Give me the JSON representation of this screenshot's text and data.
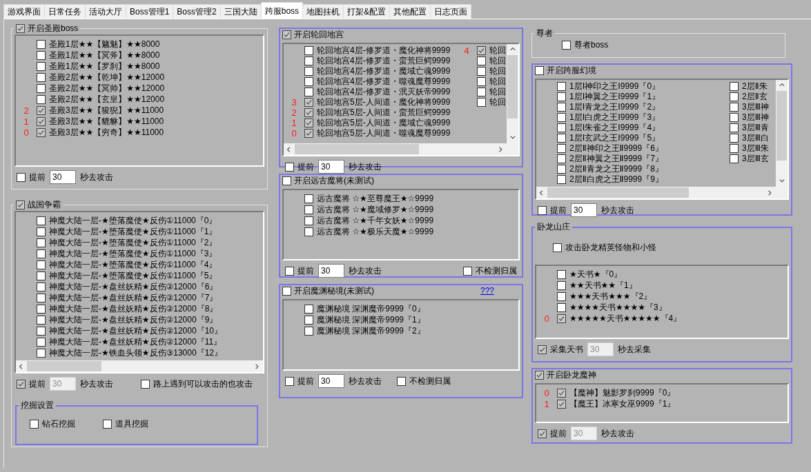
{
  "tabs": [
    {
      "label": "游戏界面",
      "selected": false
    },
    {
      "label": "日常任务",
      "selected": false
    },
    {
      "label": "活动大厅",
      "selected": false
    },
    {
      "label": "Boss管理1",
      "selected": false
    },
    {
      "label": "Boss管理2",
      "selected": false
    },
    {
      "label": "三国大陆",
      "selected": false
    },
    {
      "label": "跨服boss",
      "selected": true
    },
    {
      "label": "地图挂机",
      "selected": false
    },
    {
      "label": "打架&配置",
      "selected": false
    },
    {
      "label": "其他配置",
      "selected": false
    },
    {
      "label": "日志页面",
      "selected": false
    }
  ],
  "columns": [
    [
      {
        "kind": "etched",
        "title": "开启圣殿boss",
        "title_checked": true,
        "list": {
          "kind": "plain",
          "columns": [
            [
              {
                "checked": false,
                "label": "圣殿1层★★【魑魅】★★8000"
              },
              {
                "checked": false,
                "label": "圣殿1层★★【冥斧】★★8000"
              },
              {
                "checked": false,
                "label": "圣殿1层★★【罗刹】★★8000"
              },
              {
                "checked": false,
                "label": "圣殿2层★★【乾坤】★★12000"
              },
              {
                "checked": false,
                "label": "圣殿2层★★【冥帅】★★12000"
              },
              {
                "checked": false,
                "label": "圣殿2层★★【玄皇】★★12000"
              },
              {
                "order": "2",
                "checked": true,
                "label": "圣殿3层★★【狻猊】★★11000"
              },
              {
                "order": "1",
                "checked": true,
                "label": "圣殿3层★★【貔貅】★★11000"
              },
              {
                "order": "0",
                "checked": true,
                "label": "圣殿3层★★【穷奇】★★11000"
              }
            ]
          ]
        },
        "footer": [
          {
            "kind": "checkbox",
            "label": "提前",
            "checked": false
          },
          {
            "kind": "field",
            "value": "30",
            "disabled": false
          },
          {
            "kind": "text",
            "text": "秒去攻击"
          }
        ]
      },
      {
        "kind": "etched",
        "title": "战国争霸",
        "title_checked": true,
        "list": {
          "kind": "hscroll",
          "columns": [
            [
              {
                "checked": false,
                "label": "神魔大陆一层-★堕落魔使★反伤①11000『0』"
              },
              {
                "checked": false,
                "label": "神魔大陆一层-★堕落魔使★反伤①11000『1』"
              },
              {
                "checked": false,
                "label": "神魔大陆一层-★堕落魔使★反伤①11000『2』"
              },
              {
                "checked": false,
                "label": "神魔大陆一层-★堕落魔使★反伤①11000『3』"
              },
              {
                "checked": false,
                "label": "神魔大陆一层-★堕落魔使★反伤①11000『4』"
              },
              {
                "checked": false,
                "label": "神魔大陆一层-★堕落魔使★反伤①11000『5』"
              },
              {
                "checked": false,
                "label": "神魔大陆一层-★盘丝妖精★反伤②12000『6』"
              },
              {
                "checked": false,
                "label": "神魔大陆一层-★盘丝妖精★反伤②12000『7』"
              },
              {
                "checked": false,
                "label": "神魔大陆一层-★盘丝妖精★反伤②12000『8』"
              },
              {
                "checked": false,
                "label": "神魔大陆一层-★盘丝妖精★反伤②12000『9』"
              },
              {
                "checked": false,
                "label": "神魔大陆一层-★盘丝妖精★反伤②12000『10』"
              },
              {
                "checked": false,
                "label": "神魔大陆一层-★盘丝妖精★反伤②12000『11』"
              },
              {
                "checked": false,
                "label": "神魔大陆一层-★铁血头领★反伤③13000『12』"
              }
            ]
          ]
        },
        "footer": [
          {
            "kind": "checkbox",
            "label": "提前",
            "checked": true
          },
          {
            "kind": "field",
            "value": "30",
            "disabled": true
          },
          {
            "kind": "text",
            "text": "秒去攻击"
          },
          {
            "kind": "checkbox",
            "label": "路上遇到可以攻击的也攻击",
            "checked": false
          }
        ],
        "subpanels": [
          {
            "kind": "accent",
            "title": "挖掘设置",
            "options": [
              {
                "label": "钻石挖掘",
                "checked": false
              },
              {
                "label": "道具挖掘",
                "checked": false
              }
            ]
          }
        ]
      }
    ],
    [
      {
        "kind": "accent",
        "title": "开启轮回地宫",
        "title_checked": true,
        "list": {
          "kind": "scroll",
          "columns": [
            [
              {
                "checked": false,
                "label": "轮回地宫4层-修罗道・魔化神将9999"
              },
              {
                "checked": false,
                "label": "轮回地宫4层-修罗道・蛮荒巨鳄9999"
              },
              {
                "checked": false,
                "label": "轮回地宫4层-修罗道・魔域亡魂9999"
              },
              {
                "checked": false,
                "label": "轮回地宫4层-修罗道・噬魂魔尊9999"
              },
              {
                "checked": false,
                "label": "轮回地宫4层-修罗道・泯灭妖帝9999"
              },
              {
                "order": "3",
                "checked": true,
                "label": "轮回地宫5层-人间道・魔化神将9999"
              },
              {
                "order": "2",
                "checked": true,
                "label": "轮回地宫5层-人间道・蛮荒巨鳄9999"
              },
              {
                "order": "1",
                "checked": true,
                "label": "轮回地宫5层-人间道・魔域亡魂9999"
              },
              {
                "order": "0",
                "checked": true,
                "label": "轮回地宫5层-人间道・噬魂魔尊9999"
              }
            ],
            [
              {
                "order": "4",
                "checked": true,
                "label": "轮回"
              },
              {
                "checked": false,
                "label": "轮回"
              },
              {
                "checked": false,
                "label": "轮回"
              },
              {
                "checked": false,
                "label": "轮回"
              },
              {
                "checked": false,
                "label": "轮回"
              },
              {
                "checked": false,
                "label": "轮回"
              }
            ]
          ]
        },
        "footer": [
          {
            "kind": "checkbox",
            "label": "提前",
            "checked": false
          },
          {
            "kind": "field",
            "value": "30",
            "disabled": false
          },
          {
            "kind": "text",
            "text": "秒去攻击"
          }
        ]
      },
      {
        "kind": "accent",
        "title": "开启远古魔将(未测试)",
        "title_checked": false,
        "list": {
          "kind": "plain",
          "columns": [
            [
              {
                "checked": false,
                "label": "远古魔将 ☆★至尊魔王★☆9999"
              },
              {
                "checked": false,
                "label": "远古魔将 ☆★魔域修罗★☆9999"
              },
              {
                "checked": false,
                "label": "远古魔将 ☆★千年女妖★☆9999"
              },
              {
                "checked": false,
                "label": "远古魔将 ☆★极乐天魔★☆9999"
              }
            ]
          ]
        },
        "footer": [
          {
            "kind": "checkbox",
            "label": "提前",
            "checked": false
          },
          {
            "kind": "field",
            "value": "30",
            "disabled": false
          },
          {
            "kind": "text",
            "text": "秒去攻击"
          },
          {
            "kind": "checkbox",
            "label": "不检测归属",
            "checked": false
          }
        ]
      },
      {
        "kind": "accent",
        "title": "开启魔渊秘境(未测试)",
        "title_checked": false,
        "link": "???",
        "list": {
          "kind": "plain",
          "columns": [
            [
              {
                "checked": false,
                "label": "魔渊秘境 深渊魔帝9999『0』"
              },
              {
                "checked": false,
                "label": "魔渊秘境 深渊魔帝9999『1』"
              },
              {
                "checked": false,
                "label": "魔渊秘境 深渊魔帝9999『2』"
              }
            ]
          ]
        },
        "footer": [
          {
            "kind": "checkbox",
            "label": "提前",
            "checked": false
          },
          {
            "kind": "field",
            "value": "30",
            "disabled": false
          },
          {
            "kind": "text",
            "text": "秒去攻击"
          },
          {
            "kind": "checkbox",
            "label": "不检测归属",
            "checked": false
          }
        ]
      }
    ],
    [
      {
        "kind": "etched",
        "title": "尊者",
        "options": [
          {
            "label": "尊者boss",
            "checked": false
          }
        ]
      },
      {
        "kind": "accent",
        "title": "开启跨服幻境",
        "title_checked": false,
        "list": {
          "kind": "scroll",
          "columns": [
            [
              {
                "checked": false,
                "label": "1层Ⅰ神印之王Ⅰ9999『0』"
              },
              {
                "checked": false,
                "label": "1层Ⅰ神翼之王Ⅰ9999『1』"
              },
              {
                "checked": false,
                "label": "1层Ⅰ青龙之王Ⅰ9999『2』"
              },
              {
                "checked": false,
                "label": "1层Ⅰ白虎之王Ⅰ9999『3』"
              },
              {
                "checked": false,
                "label": "1层Ⅰ朱雀之王Ⅰ9999『4』"
              },
              {
                "checked": false,
                "label": "1层Ⅰ玄武之王Ⅰ9999『5』"
              },
              {
                "checked": false,
                "label": "2层Ⅱ神印之王Ⅱ9999『6』"
              },
              {
                "checked": false,
                "label": "2层Ⅱ神翼之王Ⅱ9999『7』"
              },
              {
                "checked": false,
                "label": "2层Ⅱ青龙之王Ⅱ9999『8』"
              },
              {
                "checked": false,
                "label": "2层Ⅱ白虎之王Ⅱ9999『9』"
              }
            ],
            [
              {
                "checked": false,
                "label": "2层Ⅱ朱"
              },
              {
                "checked": false,
                "label": "2层Ⅱ玄"
              },
              {
                "checked": false,
                "label": "3层Ⅲ神"
              },
              {
                "checked": false,
                "label": "3层Ⅲ神"
              },
              {
                "checked": false,
                "label": "3层Ⅲ青"
              },
              {
                "checked": false,
                "label": "3层Ⅲ白"
              },
              {
                "checked": false,
                "label": "3层Ⅲ朱"
              },
              {
                "checked": false,
                "label": "3层Ⅲ玄"
              }
            ]
          ]
        },
        "footer": [
          {
            "kind": "checkbox",
            "label": "提前",
            "checked": false
          },
          {
            "kind": "field",
            "value": "30",
            "disabled": false
          },
          {
            "kind": "text",
            "text": "秒去攻击"
          }
        ]
      },
      {
        "kind": "accent",
        "title": "卧龙山庄",
        "options": [
          {
            "label": "攻击卧龙精英怪物和小怪",
            "checked": false
          }
        ],
        "list": {
          "kind": "plain",
          "columns": [
            [
              {
                "checked": false,
                "label": "★天书★『0』"
              },
              {
                "checked": false,
                "label": "★★天书★★『1』"
              },
              {
                "checked": false,
                "label": "★★★天书★★★『2』"
              },
              {
                "checked": false,
                "label": "★★★★天书★★★★『3』"
              },
              {
                "order": "0",
                "checked": true,
                "label": "★★★★★天书★★★★★『4』"
              }
            ]
          ]
        },
        "footer": [
          {
            "kind": "checkbox",
            "label": "采集天书",
            "checked": true
          },
          {
            "kind": "field",
            "value": "30",
            "disabled": true
          },
          {
            "kind": "text",
            "text": "秒去采集"
          }
        ]
      },
      {
        "kind": "accent",
        "title": "开启卧龙魔神",
        "title_checked": true,
        "list": {
          "kind": "plain",
          "columns": [
            [
              {
                "order": "0",
                "checked": true,
                "label": "【魔神】魅影罗刹9999『0』"
              },
              {
                "order": "1",
                "checked": true,
                "label": "【魔王】冰寒女巫9999『1』"
              }
            ]
          ]
        },
        "footer": [
          {
            "kind": "checkbox",
            "label": "提前",
            "checked": true
          },
          {
            "kind": "field",
            "value": "30",
            "disabled": true
          },
          {
            "kind": "text",
            "text": "秒去攻击"
          }
        ]
      }
    ]
  ]
}
